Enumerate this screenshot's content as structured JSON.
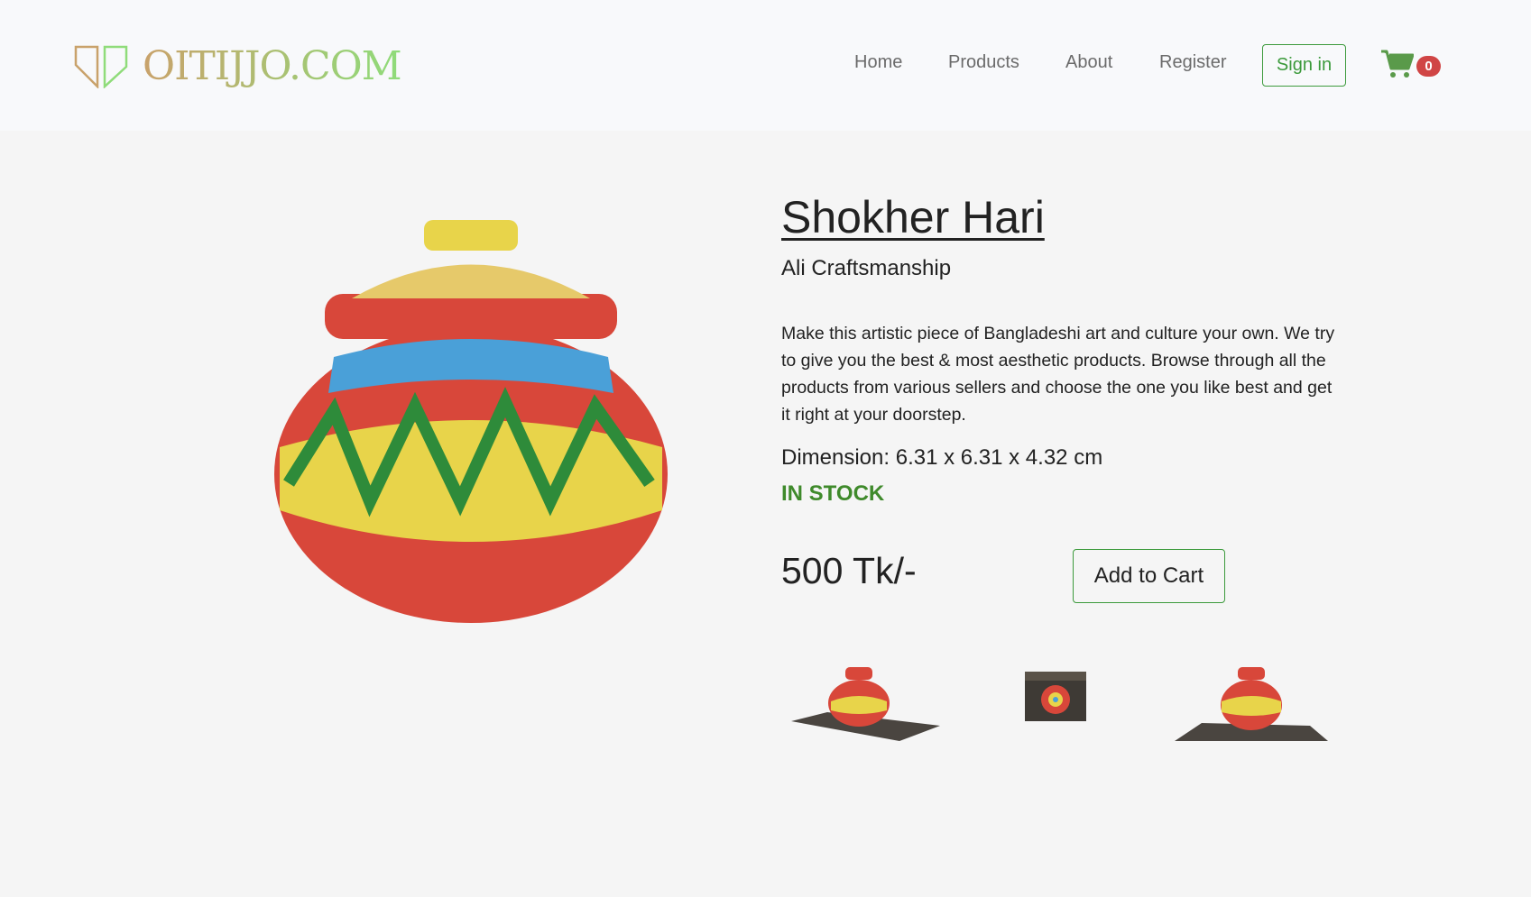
{
  "header": {
    "logo_text": "OITIJJO.COM",
    "nav": [
      {
        "label": "Home"
      },
      {
        "label": "Products"
      },
      {
        "label": "About"
      },
      {
        "label": "Register"
      }
    ],
    "signin_label": "Sign in",
    "cart_count": "0",
    "colors": {
      "accent": "#3c9a3c",
      "badge": "#d04545"
    }
  },
  "product": {
    "title": "Shokher Hari",
    "seller": "Ali Craftsmanship",
    "description": "Make this artistic piece of Bangladeshi art and culture your own. We try to give you the best & most aesthetic products. Browse through all the products from various sellers and choose the one you like best and get it right at your doorstep.",
    "dimension": "Dimension: 6.31 x 6.31 x 4.32 cm",
    "stock": "IN STOCK",
    "price": "500 Tk/-",
    "add_to_cart_label": "Add to Cart",
    "stock_color": "#3f8a2b"
  }
}
